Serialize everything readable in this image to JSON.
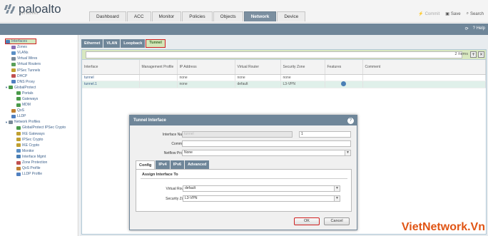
{
  "brand": {
    "logo_text": "paloalto",
    "logo_sub": "NETWORKS"
  },
  "main_tabs": [
    {
      "label": "Dashboard"
    },
    {
      "label": "ACC"
    },
    {
      "label": "Monitor"
    },
    {
      "label": "Policies"
    },
    {
      "label": "Objects"
    },
    {
      "label": "Network",
      "active": true
    },
    {
      "label": "Device"
    }
  ],
  "top_actions": {
    "commit": "Commit",
    "save": "Save",
    "search": "Search"
  },
  "bluebar": {
    "refresh_icon": "refresh-icon",
    "help": "Help"
  },
  "sidebar": {
    "items": [
      {
        "label": "Interfaces",
        "level": 1,
        "icon_color": "#4a7fb5",
        "selected": true
      },
      {
        "label": "Zones",
        "level": 1,
        "icon_color": "#8a6fb5"
      },
      {
        "label": "VLANs",
        "level": 1,
        "icon_color": "#5a8fc5"
      },
      {
        "label": "Virtual Wires",
        "level": 1,
        "icon_color": "#7a8a99"
      },
      {
        "label": "Virtual Routers",
        "level": 1,
        "icon_color": "#5aa05a"
      },
      {
        "label": "IPSec Tunnels",
        "level": 1,
        "icon_color": "#c0a030"
      },
      {
        "label": "DHCP",
        "level": 1,
        "icon_color": "#c05050"
      },
      {
        "label": "DNS Proxy",
        "level": 1,
        "icon_color": "#5080c0"
      },
      {
        "label": "GlobalProtect",
        "level": 0,
        "icon_color": "#4a9a4a"
      },
      {
        "label": "Portals",
        "level": 2,
        "icon_color": "#4a9a4a"
      },
      {
        "label": "Gateways",
        "level": 2,
        "icon_color": "#4a9a4a"
      },
      {
        "label": "MDM",
        "level": 2,
        "icon_color": "#4a9a4a"
      },
      {
        "label": "QoS",
        "level": 1,
        "icon_color": "#c08030"
      },
      {
        "label": "LLDP",
        "level": 1,
        "icon_color": "#5080c0"
      },
      {
        "label": "Network Profiles",
        "level": 0,
        "icon_color": "#7a8a99"
      },
      {
        "label": "GlobalProtect IPSec Crypto",
        "level": 2,
        "icon_color": "#4a9a4a"
      },
      {
        "label": "IKE Gateways",
        "level": 2,
        "icon_color": "#c0a030"
      },
      {
        "label": "IPSec Crypto",
        "level": 2,
        "icon_color": "#c0a030"
      },
      {
        "label": "IKE Crypto",
        "level": 2,
        "icon_color": "#c0a030"
      },
      {
        "label": "Monitor",
        "level": 2,
        "icon_color": "#5a8fc5"
      },
      {
        "label": "Interface Mgmt",
        "level": 2,
        "icon_color": "#4a7fb5"
      },
      {
        "label": "Zone Protection",
        "level": 2,
        "icon_color": "#c05050"
      },
      {
        "label": "QoS Profile",
        "level": 2,
        "icon_color": "#c08030"
      },
      {
        "label": "LLDP Profile",
        "level": 2,
        "icon_color": "#5080c0"
      }
    ]
  },
  "sub_tabs": [
    {
      "label": "Ethernet"
    },
    {
      "label": "VLAN"
    },
    {
      "label": "Loopback"
    },
    {
      "label": "Tunnel",
      "active": true
    }
  ],
  "filter": {
    "count": "2 items",
    "add_button": "+",
    "remove_button": "×"
  },
  "table": {
    "headers": [
      "Interface",
      "Management Profile",
      "IP Address",
      "Virtual Router",
      "Security Zone",
      "Features",
      "Comment"
    ],
    "rows": [
      {
        "interface": "tunnel",
        "mgmt": "",
        "ip": "none",
        "vr": "none",
        "zone": "none",
        "features": "",
        "comment": ""
      },
      {
        "interface": "tunnel.1",
        "mgmt": "",
        "ip": "none",
        "vr": "default",
        "zone": "L3-VPN",
        "features": "globe-icon",
        "comment": ""
      }
    ]
  },
  "dialog": {
    "title": "Tunnel Interface",
    "interface_name_label": "Interface Name",
    "interface_name_value": "tunnel",
    "interface_suffix_value": "1",
    "comment_label": "Comment",
    "comment_value": "",
    "netflow_label": "Netflow Profile",
    "netflow_value": "None",
    "tabs": [
      {
        "label": "Config",
        "active": true
      },
      {
        "label": "IPv4"
      },
      {
        "label": "IPv6"
      },
      {
        "label": "Advanced"
      }
    ],
    "group_title": "Assign Interface To",
    "vr_label": "Virtual Router",
    "vr_value": "default",
    "zone_label": "Security Zone",
    "zone_value": "L3-VPN",
    "ok_label": "OK",
    "cancel_label": "Cancel"
  },
  "watermark": "VietNetwork.Vn",
  "colors": {
    "accent": "#6f8699",
    "highlight": "#d02020",
    "selected_green": "#d6e8c0",
    "watermark": "#e05515"
  }
}
